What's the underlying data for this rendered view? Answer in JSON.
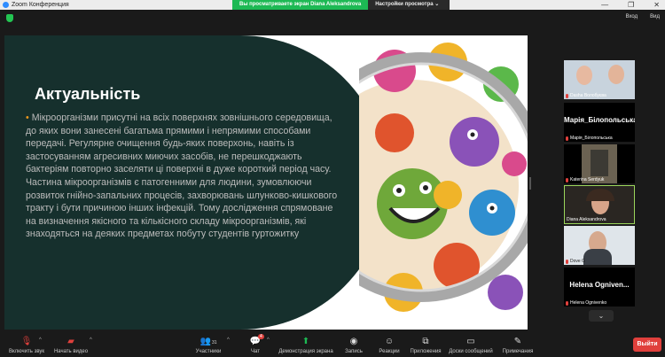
{
  "window": {
    "title": "Zoom Конференция",
    "minimize": "—",
    "maximize": "❐",
    "close": "✕"
  },
  "share_banner": {
    "status": "Вы просматриваете экран Diana Aleksandrova",
    "view_options": "Настройки просмотра"
  },
  "topbar": {
    "enter": "Вход",
    "view": "Вид"
  },
  "slide": {
    "title": "Актуальність",
    "bullet": "•",
    "body": "Мікроорганізми присутні на всіх поверхнях зовнішнього середовища, до яких вони занесені багатьма прямими і непрямими способами передачі. Регулярне очищення будь-яких поверхонь, навіть із застосуванням агресивних миючих засобів, не перешкоджають бактеріям повторно заселяти ці поверхні в дуже короткий період часу. Частина мікроорганізмів є патогенними для людини, зумовлюючи розвиток гнійно-запальних процесів, захворювань шлунково-кишкового тракту і бути причиною інших інфекцій. Тому дослідження спрямоване на визначення якісного та кількісного складу мікроорганізмів, які знаходяться на деяких предметах побуту студентів гуртожитку"
  },
  "participants": [
    {
      "name": "Dasha Волобуєва",
      "big_name": "",
      "video": true
    },
    {
      "name": "Марія_Білопольська",
      "big_name": "Марія_Білопольська...",
      "video": false
    },
    {
      "name": "Katerina Serdyuk",
      "big_name": "",
      "video": true
    },
    {
      "name": "Diana Aleksandrova",
      "big_name": "",
      "video": true,
      "active": true
    },
    {
      "name": "Dove G",
      "big_name": "",
      "video": true
    },
    {
      "name": "Helena Ognivenko",
      "big_name": "Helena Ogniven...",
      "video": false
    }
  ],
  "gallery_scroll": "⌄",
  "toolbar": {
    "mute": "Включить звук",
    "video": "Начать видео",
    "participants": "Участники",
    "participants_count": "31",
    "chat": "Чат",
    "chat_badge": "4",
    "share": "Демонстрация экрана",
    "record": "Запись",
    "reactions": "Реакции",
    "apps": "Приложения",
    "whiteboards": "Доски сообщений",
    "notes": "Примечания",
    "leave": "Выйти"
  },
  "colors": {
    "accent_green": "#1db954",
    "leave_red": "#e0403c",
    "slide_dark": "#16302d",
    "bullet": "#e8961c"
  }
}
